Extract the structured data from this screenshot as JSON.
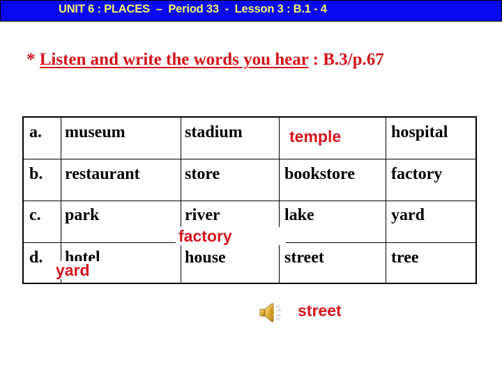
{
  "header": {
    "title": "UNIT 6 : PLACES  –  Period 33  -  Lesson 3 : B.1 - 4",
    "background_color": "#0a0aef",
    "text_color": "#f4f16a"
  },
  "instruction": {
    "prefix": "* ",
    "underlined_text": "Listen and write the words you hear",
    "suffix": " : B.3/p.67",
    "color": "#d4141b"
  },
  "table": {
    "rows": [
      {
        "label": "a.",
        "words": [
          "museum",
          "stadium",
          "temple",
          "hospital"
        ]
      },
      {
        "label": "b.",
        "words": [
          "restaurant",
          "store",
          "bookstore",
          "factory"
        ]
      },
      {
        "label": "c.",
        "words": [
          "park",
          "river",
          "lake",
          "yard"
        ]
      },
      {
        "label": "d.",
        "words": [
          "hotel",
          "house",
          "street",
          "tree"
        ]
      }
    ],
    "highlighted_cell_note": "temple shown in red"
  },
  "answers": {
    "overlay_factory": "factory",
    "overlay_yard": "yard",
    "audio_word": "street",
    "color": "#d4141b"
  },
  "audio": {
    "icon": "speaker-icon"
  }
}
